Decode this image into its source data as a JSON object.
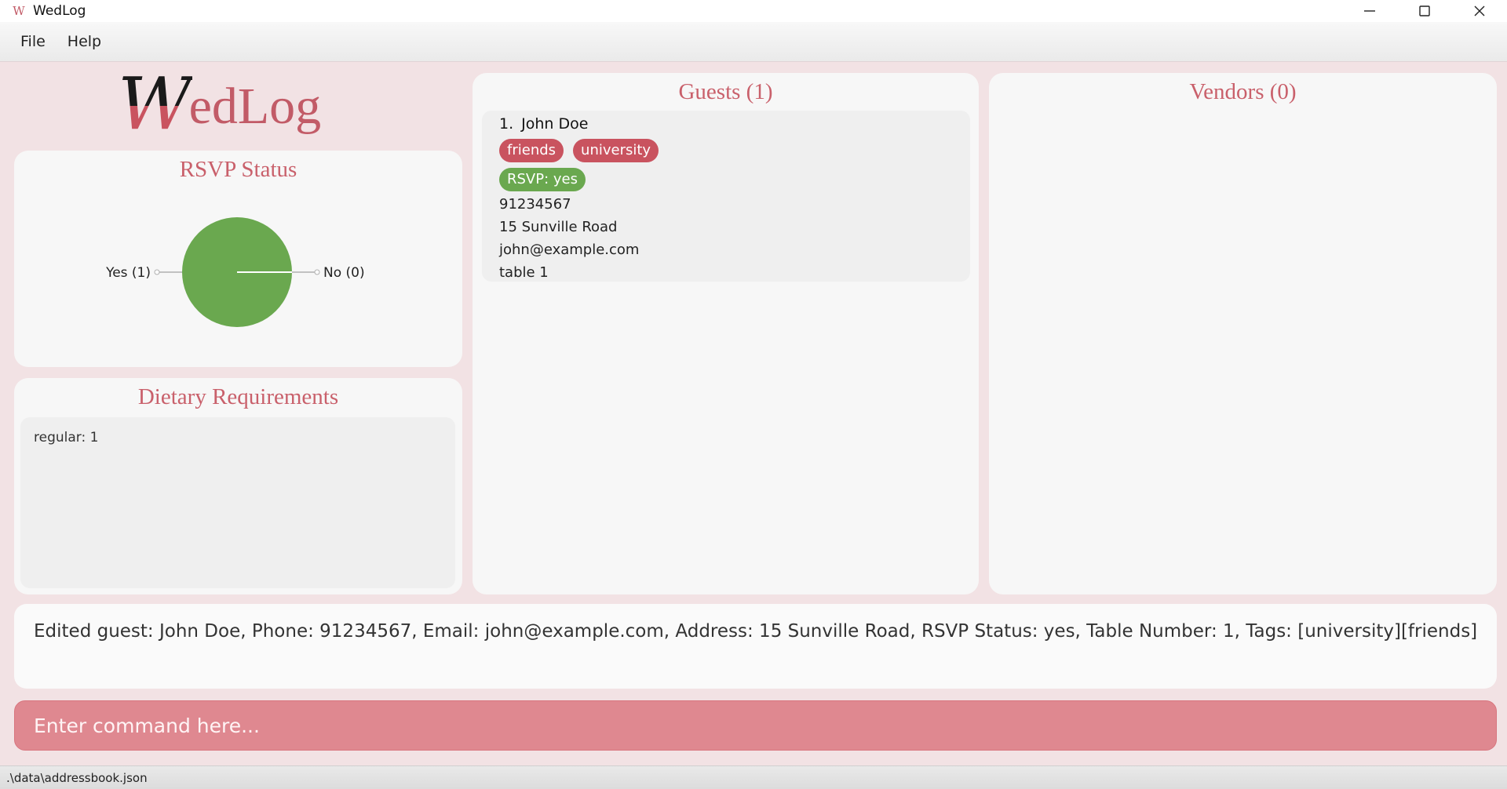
{
  "window": {
    "icon_glyph": "W",
    "title": "WedLog"
  },
  "menu": {
    "items": [
      "File",
      "Help"
    ]
  },
  "logo": {
    "first_letter": "W",
    "rest": "edLog"
  },
  "rsvp": {
    "title": "RSVP Status",
    "chart_data": {
      "type": "pie",
      "slices": [
        {
          "label": "Yes (1)",
          "value": 1,
          "color": "#6aa84f"
        },
        {
          "label": "No (0)",
          "value": 0,
          "color": "#c9535f"
        }
      ]
    }
  },
  "dietary": {
    "title": "Dietary Requirements",
    "items": [
      "regular: 1"
    ]
  },
  "guests": {
    "title": "Guests (1)",
    "list": [
      {
        "index": "1.",
        "name": "John Doe",
        "tags": [
          "friends",
          "university"
        ],
        "rsvp": "RSVP: yes",
        "phone": "91234567",
        "address": "15 Sunville Road",
        "email": "john@example.com",
        "table": "table 1"
      }
    ]
  },
  "vendors": {
    "title": "Vendors (0)"
  },
  "result": {
    "text": "Edited guest: John Doe, Phone: 91234567, Email: john@example.com, Address: 15 Sunville Road, RSVP Status: yes, Table Number: 1, Tags: [university][friends]"
  },
  "command": {
    "placeholder": "Enter command here...",
    "value": ""
  },
  "status": {
    "file_path": ".\\data\\addressbook.json"
  },
  "colors": {
    "accent": "#c9535f",
    "rsvp_yes": "#6aa84f",
    "command_bg": "#df8890",
    "background": "#f2e2e4"
  }
}
